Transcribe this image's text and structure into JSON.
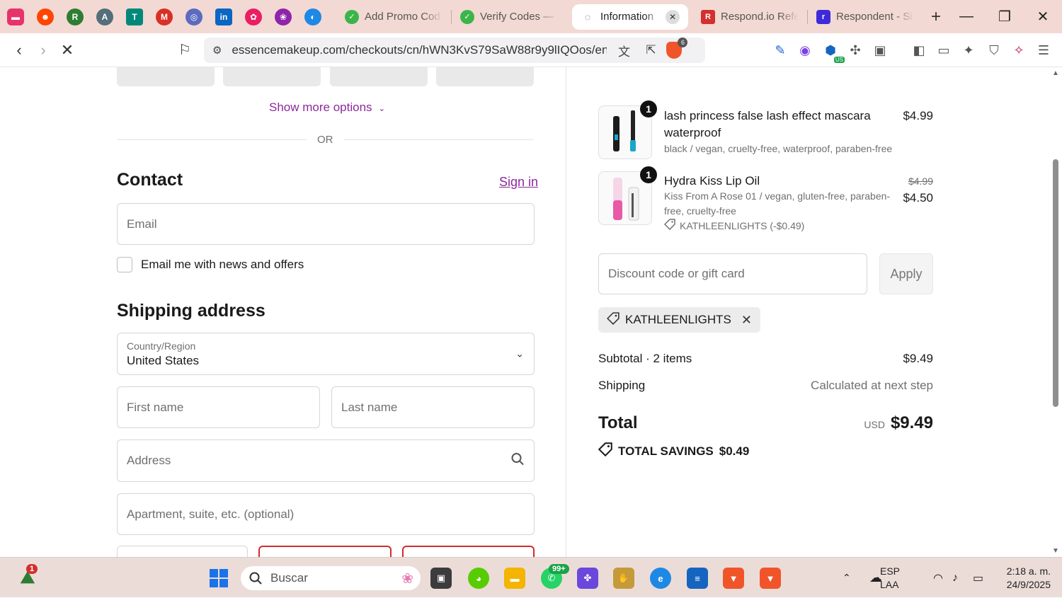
{
  "browser": {
    "pinned_tabs": [
      {
        "icon": "speech-bubble-icon",
        "color": "#e8326b"
      },
      {
        "icon": "reddit-icon",
        "color": "#ff4500"
      },
      {
        "icon": "r-icon",
        "color": "#2e7d32"
      },
      {
        "icon": "az-icon",
        "color": "#546e7a"
      },
      {
        "icon": "t-icon",
        "color": "#00897b"
      },
      {
        "icon": "gmail-icon",
        "color": "#d93025"
      },
      {
        "icon": "swirl-icon",
        "color": "#5c6bc0"
      },
      {
        "icon": "linkedin-icon",
        "color": "#0a66c2"
      },
      {
        "icon": "flower-icon",
        "color": "#e91e63"
      },
      {
        "icon": "lotus-icon",
        "color": "#8e24aa"
      },
      {
        "icon": "drop-icon",
        "color": "#1e88e5"
      }
    ],
    "tabs": [
      {
        "title": "Add Promo Cod",
        "icon": "check-leaf-icon",
        "color": "#3bb54a",
        "active": false
      },
      {
        "title": "Verify Codes —",
        "icon": "check-leaf-icon",
        "color": "#3bb54a",
        "active": false
      },
      {
        "title": "Information",
        "icon": "loading-icon",
        "color": "#555555",
        "active": true
      },
      {
        "title": "Respond.io Refe",
        "icon": "rc-icon",
        "color": "#d32f2f",
        "active": false
      },
      {
        "title": "Respondent - Si",
        "icon": "respondent-icon",
        "color": "#3d2bd9",
        "active": false
      }
    ],
    "url": "essencemakeup.com/checkouts/cn/hWN3KvS79SaW88r9y9lIQOos/en-u...",
    "brave_shield_count": "6",
    "vpn_label": "US"
  },
  "payment": {
    "show_more": "Show more options",
    "separator": "OR"
  },
  "contact": {
    "title": "Contact",
    "sign_in": "Sign in",
    "email_placeholder": "Email",
    "newsletter_label": "Email me with news and offers"
  },
  "shipping": {
    "title": "Shipping address",
    "country_label": "Country/Region",
    "country_value": "United States",
    "first_name_placeholder": "First name",
    "last_name_placeholder": "Last name",
    "address_placeholder": "Address",
    "apartment_placeholder": "Apartment, suite, etc. (optional)"
  },
  "summary": {
    "items": [
      {
        "qty": "1",
        "name": "lash princess false lash effect mascara waterproof",
        "variant": "black / vegan, cruelty-free, waterproof, paraben-free",
        "price": "$4.99"
      },
      {
        "qty": "1",
        "name": "Hydra Kiss Lip Oil",
        "variant": "Kiss From A Rose 01 / vegan, gluten-free, paraben-free, cruelty-free",
        "original_price": "$4.99",
        "price": "$4.50",
        "discount": "KATHLEENLIGHTS (-$0.49)"
      }
    ],
    "discount_placeholder": "Discount code or gift card",
    "apply_label": "Apply",
    "applied_code": "KATHLEENLIGHTS",
    "subtotal_label": "Subtotal · 2 items",
    "subtotal_value": "$9.49",
    "shipping_label": "Shipping",
    "shipping_value": "Calculated at next step",
    "total_label": "Total",
    "currency": "USD",
    "total_value": "$9.49",
    "savings_label": "TOTAL SAVINGS",
    "savings_value": "$0.49"
  },
  "taskbar": {
    "widget_badge": "1",
    "search_placeholder": "Buscar",
    "whatsapp_badge": "99+",
    "lang_line1": "ESP",
    "lang_line2": "LAA",
    "time": "2:18 a. m.",
    "date": "24/9/2025"
  },
  "colors": {
    "accent": "#8c2a9c",
    "tabstrip": "#f3d9d3",
    "error_border": "#d12c2c"
  }
}
